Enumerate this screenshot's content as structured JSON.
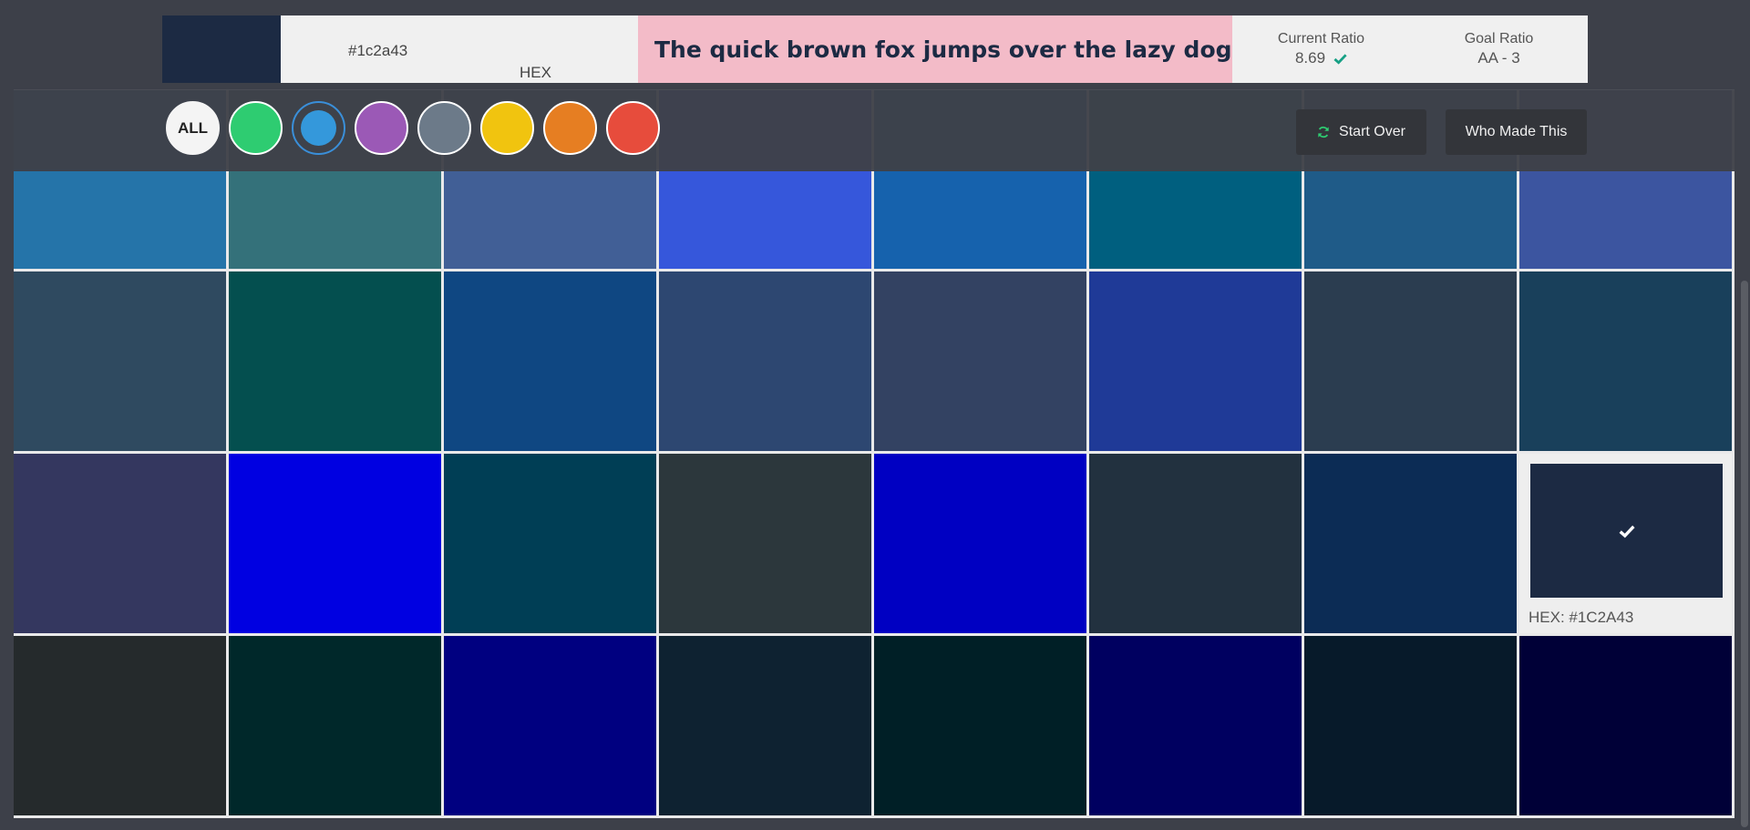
{
  "header": {
    "current_color": "#1c2a43",
    "hex_value": "#1c2a43",
    "hex_format_label": "HEX",
    "sample_text": "The quick brown fox jumps over the lazy dog.",
    "sample_background": "#f3bbc8",
    "current_ratio_label": "Current Ratio",
    "current_ratio_value": "8.69",
    "current_ratio_status_icon": "check-icon",
    "goal_ratio_label": "Goal Ratio",
    "goal_ratio_value": "AA - 3"
  },
  "toolbar": {
    "filters": [
      {
        "name": "filter-all",
        "label": "ALL",
        "color": "#f4f4f4",
        "active": false
      },
      {
        "name": "filter-green",
        "color": "#2ecc71",
        "active": false
      },
      {
        "name": "filter-blue",
        "color": "#3498db",
        "active": true
      },
      {
        "name": "filter-purple",
        "color": "#9b59b6",
        "active": false
      },
      {
        "name": "filter-gray",
        "color": "#6c7a89",
        "active": false
      },
      {
        "name": "filter-yellow",
        "color": "#f1c40f",
        "active": false
      },
      {
        "name": "filter-orange",
        "color": "#e67e22",
        "active": false
      },
      {
        "name": "filter-red",
        "color": "#e74c3c",
        "active": false
      }
    ],
    "start_over_label": "Start Over",
    "start_over_icon": "refresh-icon",
    "who_made_label": "Who Made This"
  },
  "swatches": [
    "#2574a9",
    "#34717a",
    "#415f96",
    "#3657db",
    "#1662ad",
    "#005f7f",
    "#1f5b88",
    "#3c55a0",
    "#2f4a60",
    "#044f4f",
    "#0f4782",
    "#2d4771",
    "#334262",
    "#1f3a97",
    "#2b3d50",
    "#19405b",
    "#34375f",
    "#0000e1",
    "#003e55",
    "#2c373c",
    "#0000c2",
    "#22313f",
    "#0c2c55",
    "#1c2a43",
    "#252a2c",
    "#00282a",
    "#000080",
    "#0e2231",
    "#001f26",
    "#000060",
    "#071a2a",
    "#000037"
  ],
  "selected_swatch": {
    "index": 23,
    "hex_label": "HEX: #1C2A43",
    "icon": "check-icon"
  }
}
